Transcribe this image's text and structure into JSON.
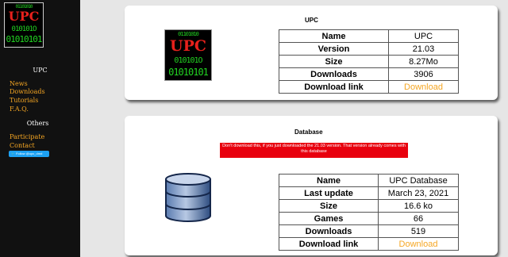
{
  "sidebar": {
    "logo": {
      "bin1": "01101010",
      "title": "UPC",
      "bin2": "010101O",
      "bin3": "01010101"
    },
    "title": "UPC",
    "links": [
      "News",
      "Downloads",
      "Tutorials",
      "F.A.Q."
    ],
    "others_title": "Others",
    "links2": [
      "Participate",
      "Contact"
    ],
    "twitter": "Follow @upc_dmd"
  },
  "cards": {
    "upc": {
      "title": "UPC",
      "rows": [
        {
          "key": "Name",
          "value": "UPC"
        },
        {
          "key": "Version",
          "value": "21.03"
        },
        {
          "key": "Size",
          "value": "8.27Mo"
        },
        {
          "key": "Downloads",
          "value": "3906"
        },
        {
          "key": "Download link",
          "value": "Download"
        }
      ]
    },
    "database": {
      "title": "Database",
      "warning": "Don't download this, if you just downloaded the 21.03 version. That version already comes with this database",
      "rows": [
        {
          "key": "Name",
          "value": "UPC Database"
        },
        {
          "key": "Last update",
          "value": "March 23, 2021"
        },
        {
          "key": "Size",
          "value": "16.6 ko"
        },
        {
          "key": "Games",
          "value": "66"
        },
        {
          "key": "Downloads",
          "value": "519"
        },
        {
          "key": "Download link",
          "value": "Download"
        }
      ]
    }
  },
  "colors": {
    "link": "#f5a623",
    "warning_bg": "#e8000e",
    "logo_green": "#22d422",
    "logo_red": "#e8211c"
  }
}
